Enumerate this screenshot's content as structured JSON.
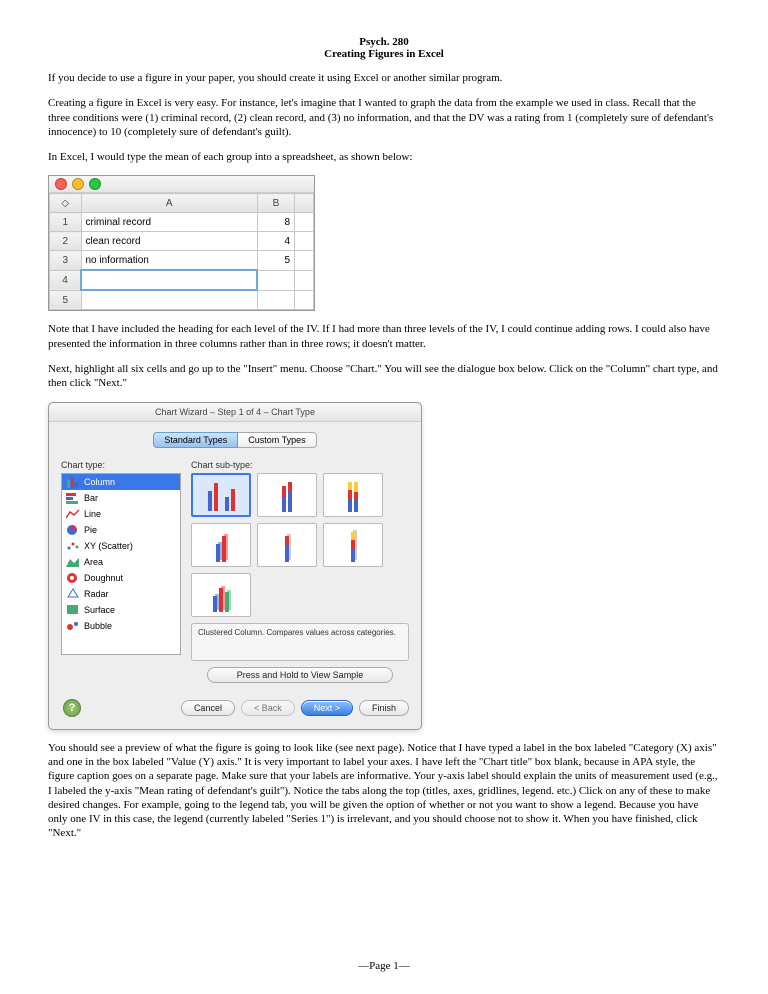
{
  "header": {
    "line1": "Psych. 280",
    "line2": "Creating Figures in Excel"
  },
  "p1": "If you decide to use a figure in your paper, you should create it using Excel or another similar program.",
  "p2": "Creating a figure in Excel is very easy. For instance, let's imagine that I wanted to graph the data from the example we used in class. Recall that the three conditions were (1) criminal record, (2) clean record, and (3) no information, and that the DV was a rating from 1 (completely sure of defendant's innocence) to 10 (completely sure of defendant's guilt).",
  "p3": "In Excel, I would type the mean of each group into a spreadsheet, as shown below:",
  "excel": {
    "cols": [
      "A",
      "B"
    ],
    "rows": [
      {
        "n": "1",
        "a": "criminal record",
        "b": "8"
      },
      {
        "n": "2",
        "a": "clean record",
        "b": "4"
      },
      {
        "n": "3",
        "a": "no information",
        "b": "5"
      },
      {
        "n": "4",
        "a": "",
        "b": ""
      },
      {
        "n": "5",
        "a": "",
        "b": ""
      }
    ]
  },
  "p4": "Note that I have included the heading for each level of the IV. If I had more than three levels of the IV, I could continue adding rows. I could also have presented the information in three columns rather than in three rows; it doesn't matter.",
  "p5": "Next, highlight all six cells and go up to the \"Insert\" menu. Choose \"Chart.\" You will see the dialogue box below.  Click on the \"Column\" chart type, and then click \"Next.\"",
  "wizard": {
    "title": "Chart Wizard – Step 1 of 4 – Chart Type",
    "tab_standard": "Standard Types",
    "tab_custom": "Custom Types",
    "left_label": "Chart type:",
    "right_label": "Chart sub-type:",
    "types": [
      "Column",
      "Bar",
      "Line",
      "Pie",
      "XY (Scatter)",
      "Area",
      "Doughnut",
      "Radar",
      "Surface",
      "Bubble"
    ],
    "subtype_desc": "Clustered Column. Compares values across categories.",
    "sample_btn": "Press and Hold to View Sample",
    "btn_cancel": "Cancel",
    "btn_back": "< Back",
    "btn_next": "Next >",
    "btn_finish": "Finish"
  },
  "p6": "You should see a preview of what the figure is going to look like (see next page). Notice that I have typed a label in the box labeled \"Category (X) axis\" and one in the box labeled \"Value (Y) axis.\" It is very important to label your axes. I have left the \"Chart title\" box blank, because in APA style, the figure caption goes on a separate page. Make sure that your labels are informative. Your y-axis label should explain the units of measurement used (e.g., I labeled the y-axis \"Mean rating of defendant's guilt\").  Notice the tabs along the top (titles, axes, gridlines, legend. etc.) Click on any of these to make desired changes. For example, going to the legend tab, you will be given the option of whether or not you want to show a legend. Because you  have only one IV in this case, the legend (currently labeled \"Series 1\") is irrelevant, and you should choose not to show it. When you have finished, click \"Next.\"",
  "footer": "—Page 1—"
}
